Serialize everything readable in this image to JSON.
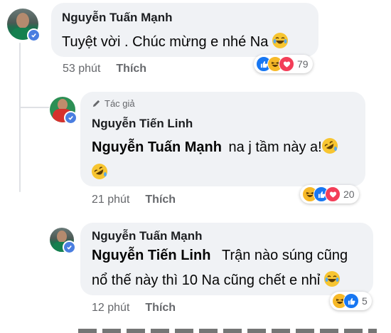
{
  "comments": [
    {
      "author": "Nguyễn Tuấn Mạnh",
      "text": "Tuyệt vời . Chúc mừng e nhé Na",
      "time": "53 phút",
      "like_label": "Thích",
      "reactions": [
        "like-icon",
        "haha-icon",
        "love-icon"
      ],
      "reaction_count": "79"
    },
    {
      "author_badge": "Tác giả",
      "author": "Nguyễn Tiến Linh",
      "mention": "Nguyễn Tuấn Mạnh",
      "text": "na j tầm này a!",
      "time": "21 phút",
      "like_label": "Thích",
      "reactions": [
        "haha-icon",
        "like-icon",
        "love-icon"
      ],
      "reaction_count": "20"
    },
    {
      "author": "Nguyễn Tuấn Mạnh",
      "mention": "Nguyễn Tiến Linh",
      "text_line1": "Trận nào súng cũng",
      "text_line2": "nổ thế này thì 10 Na cũng chết e nhỉ",
      "time": "12 phút",
      "like_label": "Thích",
      "reactions": [
        "haha-icon",
        "like-icon"
      ],
      "reaction_count": "5"
    }
  ],
  "colors": {
    "bubble": "#f0f2f5",
    "meta": "#65676b",
    "like": "#1877f2",
    "love": "#f33e58",
    "haha": "#f7b928"
  }
}
